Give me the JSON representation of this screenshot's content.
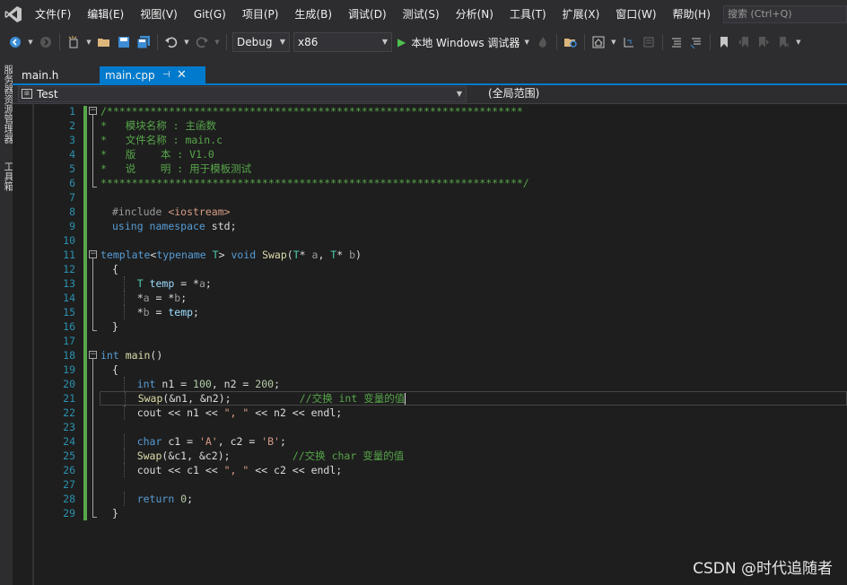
{
  "menu": {
    "items": [
      "文件(F)",
      "编辑(E)",
      "视图(V)",
      "Git(G)",
      "项目(P)",
      "生成(B)",
      "调试(D)",
      "测试(S)",
      "分析(N)",
      "工具(T)",
      "扩展(X)",
      "窗口(W)",
      "帮助(H)"
    ],
    "search_placeholder": "搜索 (Ctrl+Q)"
  },
  "toolbar": {
    "config": "Debug",
    "platform": "x86",
    "run_label": "本地 Windows 调试器"
  },
  "left_strip": {
    "tab1": "服务器资源管理器",
    "tab2": "工具箱"
  },
  "tabs": {
    "inactive_tab": "main.h",
    "active_tab": "main.cpp"
  },
  "navbar": {
    "scope_left": "Test",
    "scope_right": "(全局范围)"
  },
  "editor": {
    "line_numbers": [
      "1",
      "2",
      "3",
      "4",
      "5",
      "6",
      "7",
      "8",
      "9",
      "10",
      "11",
      "12",
      "13",
      "14",
      "15",
      "16",
      "17",
      "18",
      "19",
      "20",
      "21",
      "22",
      "23",
      "24",
      "25",
      "26",
      "27",
      "28",
      "29"
    ],
    "lines": [
      [
        {
          "t": "/*******************************************************************",
          "c": "c-comment"
        }
      ],
      [
        {
          "t": "*   模块名称 : 主函数",
          "c": "c-comment"
        }
      ],
      [
        {
          "t": "*   文件名称 : main.c",
          "c": "c-comment"
        }
      ],
      [
        {
          "t": "*   版    本 : V1.0",
          "c": "c-comment"
        }
      ],
      [
        {
          "t": "*   说    明 : 用于模板测试",
          "c": "c-comment"
        }
      ],
      [
        {
          "t": "********************************************************************/",
          "c": "c-comment"
        }
      ],
      [],
      [
        {
          "t": "#include ",
          "c": "c-pre"
        },
        {
          "t": "<iostream>",
          "c": "c-string"
        }
      ],
      [
        {
          "t": "using ",
          "c": "c-keyword"
        },
        {
          "t": "namespace ",
          "c": "c-keyword"
        },
        {
          "t": "std;",
          "c": "c-plain"
        }
      ],
      [],
      [
        {
          "t": "template",
          "c": "c-keyword"
        },
        {
          "t": "<",
          "c": "c-plain"
        },
        {
          "t": "typename ",
          "c": "c-keyword"
        },
        {
          "t": "T",
          "c": "c-type"
        },
        {
          "t": "> ",
          "c": "c-plain"
        },
        {
          "t": "void ",
          "c": "c-keyword"
        },
        {
          "t": "Swap",
          "c": "c-func"
        },
        {
          "t": "(",
          "c": "c-plain"
        },
        {
          "t": "T",
          "c": "c-type"
        },
        {
          "t": "* ",
          "c": "c-plain"
        },
        {
          "t": "a",
          "c": "c-param"
        },
        {
          "t": ", ",
          "c": "c-plain"
        },
        {
          "t": "T",
          "c": "c-type"
        },
        {
          "t": "* ",
          "c": "c-plain"
        },
        {
          "t": "b",
          "c": "c-param"
        },
        {
          "t": ")",
          "c": "c-plain"
        }
      ],
      [
        {
          "t": "{",
          "c": "c-plain"
        }
      ],
      [
        {
          "t": "    ",
          "c": "c-plain"
        },
        {
          "t": "T ",
          "c": "c-type"
        },
        {
          "t": "temp",
          "c": "c-local"
        },
        {
          "t": " = *",
          "c": "c-plain"
        },
        {
          "t": "a",
          "c": "c-param"
        },
        {
          "t": ";",
          "c": "c-plain"
        }
      ],
      [
        {
          "t": "    *",
          "c": "c-plain"
        },
        {
          "t": "a",
          "c": "c-param"
        },
        {
          "t": " = *",
          "c": "c-plain"
        },
        {
          "t": "b",
          "c": "c-param"
        },
        {
          "t": ";",
          "c": "c-plain"
        }
      ],
      [
        {
          "t": "    *",
          "c": "c-plain"
        },
        {
          "t": "b",
          "c": "c-param"
        },
        {
          "t": " = ",
          "c": "c-plain"
        },
        {
          "t": "temp",
          "c": "c-local"
        },
        {
          "t": ";",
          "c": "c-plain"
        }
      ],
      [
        {
          "t": "}",
          "c": "c-plain"
        }
      ],
      [],
      [
        {
          "t": "int ",
          "c": "c-keyword"
        },
        {
          "t": "main",
          "c": "c-func"
        },
        {
          "t": "()",
          "c": "c-plain"
        }
      ],
      [
        {
          "t": "{",
          "c": "c-plain"
        }
      ],
      [
        {
          "t": "    ",
          "c": "c-plain"
        },
        {
          "t": "int ",
          "c": "c-keyword"
        },
        {
          "t": "n1 = ",
          "c": "c-plain"
        },
        {
          "t": "100",
          "c": "c-number"
        },
        {
          "t": ", n2 = ",
          "c": "c-plain"
        },
        {
          "t": "200",
          "c": "c-number"
        },
        {
          "t": ";",
          "c": "c-plain"
        }
      ],
      [
        {
          "t": "    ",
          "c": "c-plain"
        },
        {
          "t": "Swap",
          "c": "c-func"
        },
        {
          "t": "(&n1, &n2);           ",
          "c": "c-plain"
        },
        {
          "t": "//交换 int 变量的值",
          "c": "c-comment"
        },
        {
          "t": "|caret|",
          "c": "caret"
        }
      ],
      [
        {
          "t": "    cout << n1 << ",
          "c": "c-plain"
        },
        {
          "t": "\", \"",
          "c": "c-string"
        },
        {
          "t": " << n2 << endl;",
          "c": "c-plain"
        }
      ],
      [],
      [
        {
          "t": "    ",
          "c": "c-plain"
        },
        {
          "t": "char ",
          "c": "c-keyword"
        },
        {
          "t": "c1 = ",
          "c": "c-plain"
        },
        {
          "t": "'A'",
          "c": "c-string"
        },
        {
          "t": ", c2 = ",
          "c": "c-plain"
        },
        {
          "t": "'B'",
          "c": "c-string"
        },
        {
          "t": ";",
          "c": "c-plain"
        }
      ],
      [
        {
          "t": "    ",
          "c": "c-plain"
        },
        {
          "t": "Swap",
          "c": "c-func"
        },
        {
          "t": "(&c1, &c2);          ",
          "c": "c-plain"
        },
        {
          "t": "//交换 char 变量的值",
          "c": "c-comment"
        }
      ],
      [
        {
          "t": "    cout << c1 << ",
          "c": "c-plain"
        },
        {
          "t": "\", \"",
          "c": "c-string"
        },
        {
          "t": " << c2 << endl;",
          "c": "c-plain"
        }
      ],
      [],
      [
        {
          "t": "    ",
          "c": "c-plain"
        },
        {
          "t": "return ",
          "c": "c-keyword"
        },
        {
          "t": "0",
          "c": "c-number"
        },
        {
          "t": ";",
          "c": "c-plain"
        }
      ],
      [
        {
          "t": "}",
          "c": "c-plain"
        }
      ]
    ]
  },
  "watermark": "CSDN @时代追随者"
}
